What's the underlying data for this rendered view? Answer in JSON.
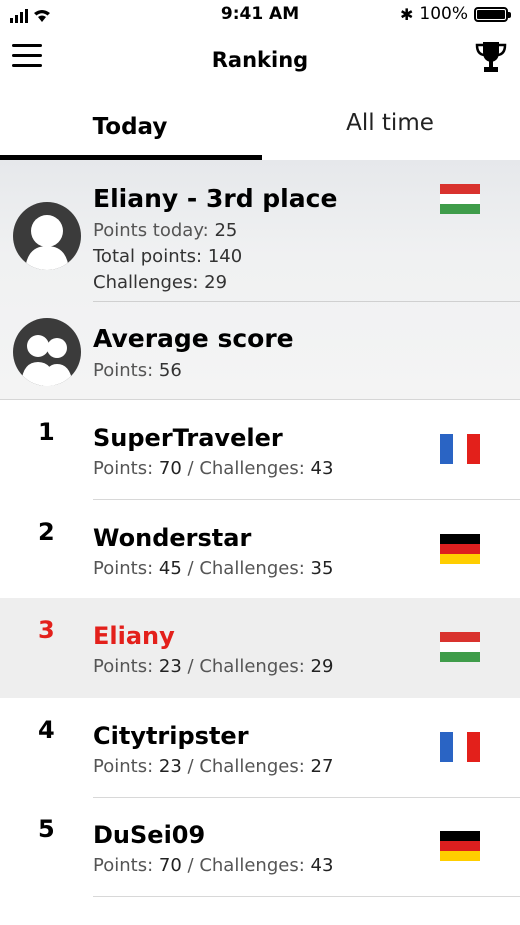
{
  "status_bar": {
    "time": "9:41 AM",
    "battery": "100%"
  },
  "header": {
    "title": "Ranking",
    "menu_icon": "hamburger-menu-icon",
    "trophy_icon": "trophy-icon"
  },
  "tabs": [
    {
      "label": "Today",
      "selected": true
    },
    {
      "label": "All time",
      "selected": false
    }
  ],
  "me": {
    "title": "Eliany - 3rd place",
    "points_today_label": "Points today:",
    "points_today": "25",
    "total_points_label": "Total points:",
    "total_points": "140",
    "challenges_label": "Challenges:",
    "challenges": "29",
    "flag": "hungary"
  },
  "average": {
    "title": "Average score",
    "points_label": "Points:",
    "points": "56"
  },
  "labels": {
    "points": "Points:",
    "challenges": "Challenges:",
    "separator": "/"
  },
  "colors": {
    "highlight_text": "#e3201b",
    "highlight_bg": "#eeeeee"
  },
  "ranking": [
    {
      "rank": "1",
      "name": "SuperTraveler",
      "points": "70",
      "challenges": "43",
      "flag": "france",
      "highlight": false
    },
    {
      "rank": "2",
      "name": "Wonderstar",
      "points": "45",
      "challenges": "35",
      "flag": "germany",
      "highlight": false
    },
    {
      "rank": "3",
      "name": "Eliany",
      "points": "23",
      "challenges": "29",
      "flag": "hungary",
      "highlight": true
    },
    {
      "rank": "4",
      "name": "Citytripster",
      "points": "23",
      "challenges": "27",
      "flag": "france",
      "highlight": false
    },
    {
      "rank": "5",
      "name": "DuSei09",
      "points": "70",
      "challenges": "43",
      "flag": "germany",
      "highlight": false
    }
  ]
}
